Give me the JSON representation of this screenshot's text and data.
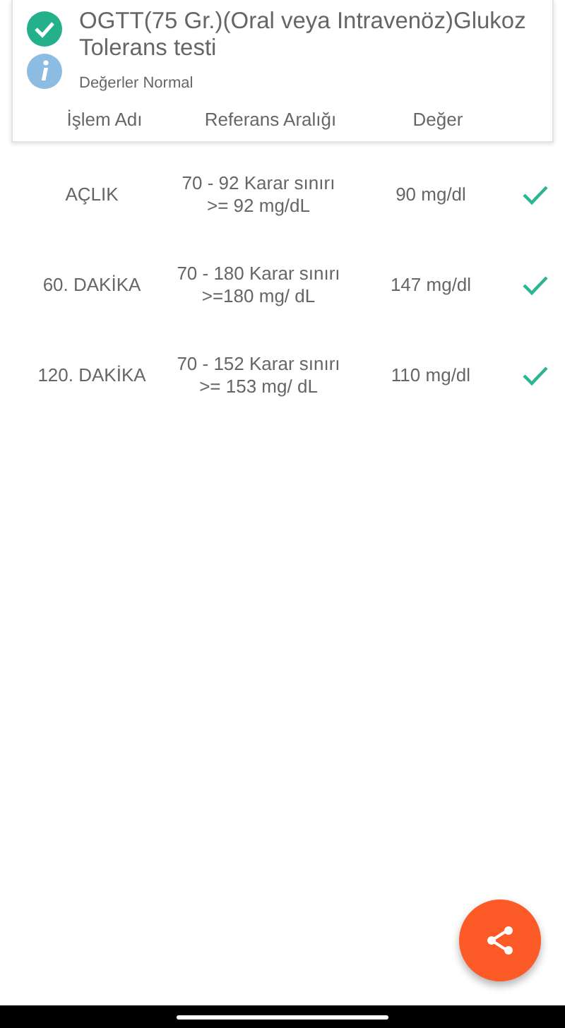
{
  "test": {
    "title": "OGTT(75 Gr.)(Oral veya Intravenöz)Glukoz Tolerans testi",
    "normal": true,
    "summary": "Değerler Normal"
  },
  "table": {
    "columns": [
      "İşlem Adı",
      "Referans Aralığı",
      "Değer"
    ],
    "rows": [
      {
        "name": "AÇLIK",
        "range": "70 - 92 Karar sınırı >= 92 mg/dL",
        "value": "90 mg/dl",
        "normal": true
      },
      {
        "name": "60. DAKİKA",
        "range": "70 - 180 Karar sınırı >=180 mg/ dL",
        "value": "147 mg/dl",
        "normal": true
      },
      {
        "name": "120. DAKİKA",
        "range": "70 - 152 Karar sınırı >= 153 mg/ dL",
        "value": "110 mg/dl",
        "normal": true
      }
    ]
  }
}
